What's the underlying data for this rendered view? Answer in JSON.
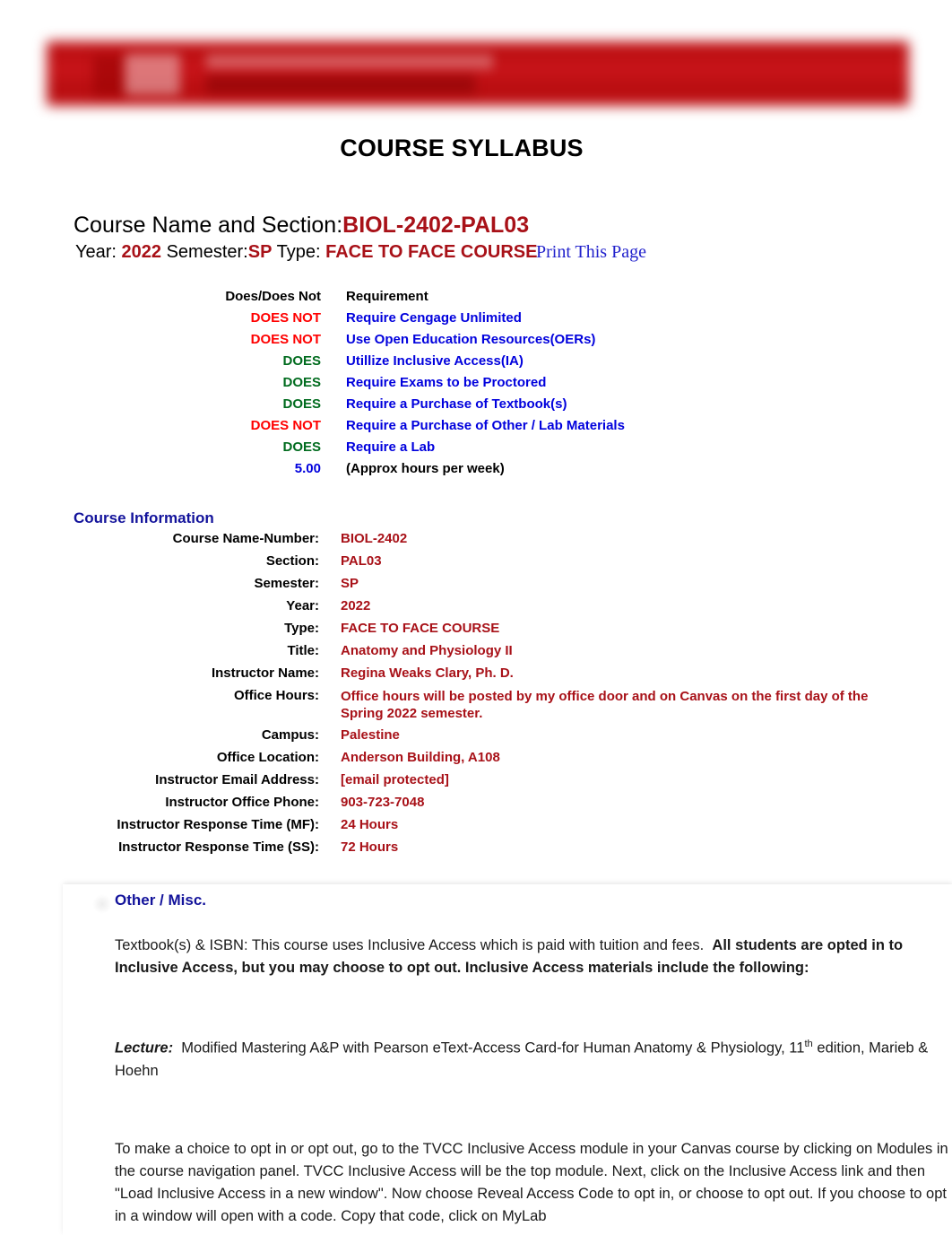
{
  "header": {
    "banner_alt": "institution-logo-banner"
  },
  "page_title": "COURSE SYLLABUS",
  "course_heading": {
    "label": "Course Name and Section:",
    "value": "BIOL-2402-PAL03"
  },
  "meta": {
    "year_label": "Year:",
    "year_value": "2022",
    "semester_label": "Semester:",
    "semester_value": "SP",
    "type_label": "Type:",
    "type_value": "FACE TO FACE COURSE",
    "print_link": "Print This Page"
  },
  "requirements": {
    "col1_header": "Does/Does Not",
    "col2_header": "Requirement",
    "rows": [
      {
        "status": "DOES NOT",
        "status_kind": "neg",
        "requirement": "Require Cengage Unlimited",
        "req_kind": "req"
      },
      {
        "status": "DOES NOT",
        "status_kind": "neg",
        "requirement": "Use Open Education Resources(OERs)",
        "req_kind": "req"
      },
      {
        "status": "DOES",
        "status_kind": "pos",
        "requirement": "Utillize Inclusive Access(IA)",
        "req_kind": "req"
      },
      {
        "status": "DOES",
        "status_kind": "pos",
        "requirement": "Require Exams to be Proctored",
        "req_kind": "req"
      },
      {
        "status": "DOES",
        "status_kind": "pos",
        "requirement": "Require a Purchase of Textbook(s)",
        "req_kind": "req"
      },
      {
        "status": "DOES NOT",
        "status_kind": "neg",
        "requirement": "Require a Purchase of Other / Lab Materials",
        "req_kind": "req"
      },
      {
        "status": "DOES",
        "status_kind": "pos",
        "requirement": "Require a Lab",
        "req_kind": "req"
      },
      {
        "status": "5.00",
        "status_kind": "num",
        "requirement": "(Approx hours per week)",
        "req_kind": "plain"
      }
    ]
  },
  "course_information": {
    "heading": "Course Information",
    "rows": [
      {
        "label": "Course Name-Number:",
        "value": "BIOL-2402"
      },
      {
        "label": "Section:",
        "value": "PAL03"
      },
      {
        "label": "Semester:",
        "value": "SP"
      },
      {
        "label": "Year:",
        "value": "2022"
      },
      {
        "label": "Type:",
        "value": "FACE TO FACE COURSE"
      },
      {
        "label": "Title:",
        "value": "Anatomy and Physiology II"
      },
      {
        "label": "Instructor Name:",
        "value": "Regina Weaks Clary, Ph. D."
      },
      {
        "label": "Office Hours:",
        "value": "Office hours will be posted by my office door and on Canvas on the first day of the Spring 2022 semester."
      },
      {
        "label": "Campus:",
        "value": "Palestine"
      },
      {
        "label": "Office Location:",
        "value": "Anderson Building, A108"
      },
      {
        "label": "Instructor Email Address:",
        "value": "[email protected]"
      },
      {
        "label": "Instructor Office Phone:",
        "value": "903-723-7048"
      },
      {
        "label": "Instructor Response Time (MF):",
        "value": "24 Hours"
      },
      {
        "label": "Instructor Response Time (SS):",
        "value": "72 Hours"
      }
    ]
  },
  "other_misc": {
    "heading": "Other / Misc.",
    "paragraph1_normal": "Textbook(s) & ISBN: This course uses Inclusive Access which is paid with tuition and fees.",
    "paragraph1_bold": "All students are opted in to Inclusive Access, but you may choose to opt out. Inclusive Access materials include the following:",
    "lecture_label": "Lecture:",
    "lecture_text_a": "Modified Mastering A&P with Pearson eText-Access Card-for Human Anatomy & Physiology, 11",
    "lecture_sup": "th",
    "lecture_text_b": "edition, Marieb & Hoehn",
    "paragraph3": "To make a choice to opt in or opt out, go to the TVCC Inclusive Access module in your Canvas course by clicking on Modules in the course navigation panel. TVCC Inclusive Access will be the top module. Next, click on the Inclusive Access link and then \"Load Inclusive Access in a new window\". Now choose Reveal Access Code to opt in, or choose to opt out. If you choose to opt in a window will open with a code. Copy that code, click on MyLab"
  },
  "colors": {
    "brand_red": "#a81118",
    "banner_red": "#c41216",
    "requirement_blue": "#0000dd",
    "heading_blue": "#13139b",
    "negative_red": "#ff0000",
    "positive_green": "#006b1e",
    "link_blue": "#2222cc"
  }
}
